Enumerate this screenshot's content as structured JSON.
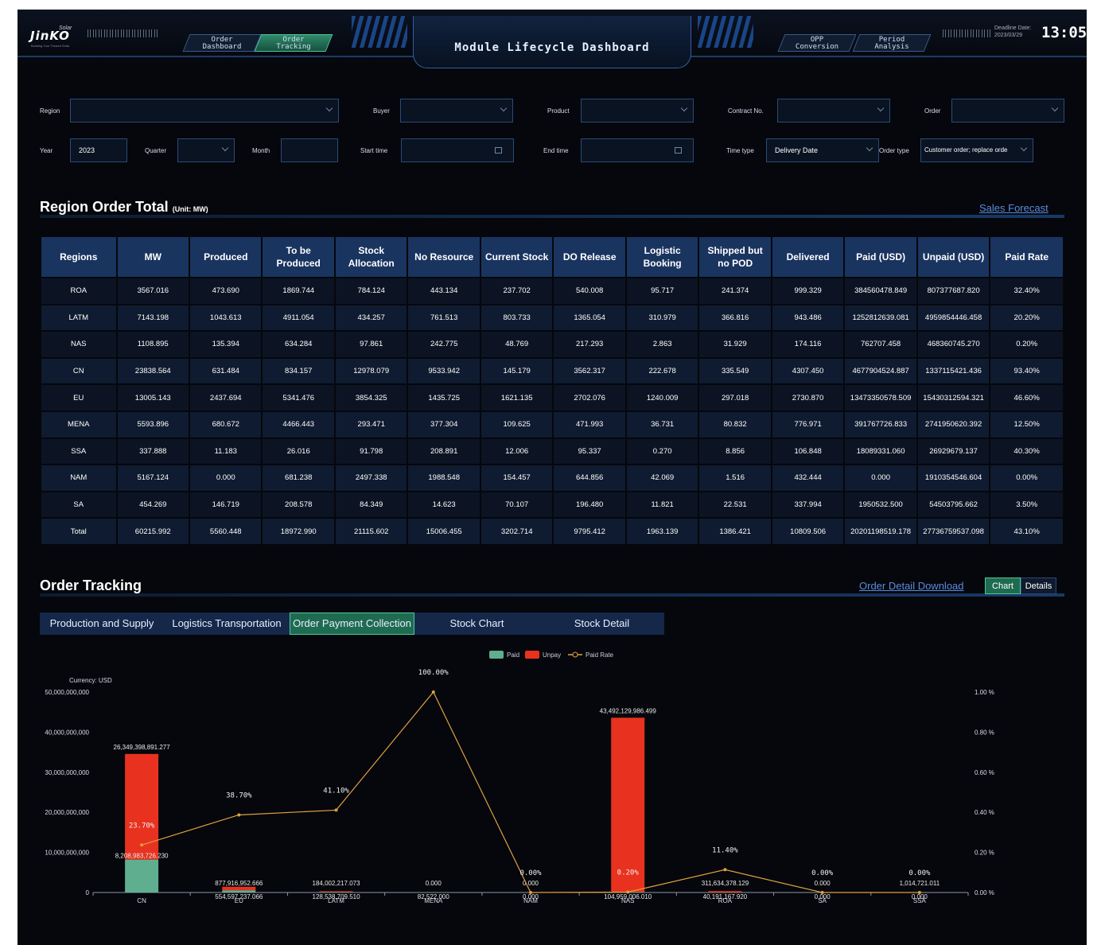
{
  "header": {
    "logo_text": "JinKO",
    "logo_sub": "Solar",
    "logo_tagline": "Building Your Trusted Solar",
    "nav_left": [
      {
        "label": "Order\nDashboard",
        "active": false
      },
      {
        "label": "Order\nTracking",
        "active": true
      }
    ],
    "title": "Module Lifecycle Dashboard",
    "nav_right": [
      {
        "label": "OPP\nConversion",
        "active": false
      },
      {
        "label": "Period\nAnalysis",
        "active": false
      }
    ],
    "deadline_label": "Deadline Date:",
    "deadline_date": "2023/03/29",
    "clock": "13:05"
  },
  "filters": {
    "region": {
      "label": "Region",
      "value": ""
    },
    "buyer": {
      "label": "Buyer",
      "value": ""
    },
    "product": {
      "label": "Product",
      "value": ""
    },
    "contract": {
      "label": "Contract No.",
      "value": ""
    },
    "order": {
      "label": "Order",
      "value": ""
    },
    "year": {
      "label": "Year",
      "value": "2023"
    },
    "quarter": {
      "label": "Quarter",
      "value": ""
    },
    "month": {
      "label": "Month",
      "value": ""
    },
    "start_time": {
      "label": "Start time",
      "value": ""
    },
    "end_time": {
      "label": "End time",
      "value": ""
    },
    "time_type": {
      "label": "Time type",
      "value": "Delivery Date"
    },
    "order_type": {
      "label": "Order type",
      "value": "Customer order; replace orde"
    }
  },
  "region_section": {
    "title": "Region Order Total",
    "unit": "(Unit: MW)",
    "link": "Sales Forecast",
    "columns": [
      "Regions",
      "MW",
      "Produced",
      "To be Produced",
      "Stock Allocation",
      "No Resource",
      "Current Stock",
      "DO Release",
      "Logistic Booking",
      "Shipped but no POD",
      "Delivered",
      "Paid (USD)",
      "Unpaid (USD)",
      "Paid Rate"
    ],
    "rows": [
      [
        "ROA",
        "3567.016",
        "473.690",
        "1869.744",
        "784.124",
        "443.134",
        "237.702",
        "540.008",
        "95.717",
        "241.374",
        "999.329",
        "384560478.849",
        "807377687.820",
        "32.40%"
      ],
      [
        "LATM",
        "7143.198",
        "1043.613",
        "4911.054",
        "434.257",
        "761.513",
        "803.733",
        "1365.054",
        "310.979",
        "366.816",
        "943.486",
        "1252812639.081",
        "4959854446.458",
        "20.20%"
      ],
      [
        "NAS",
        "1108.895",
        "135.394",
        "634.284",
        "97.861",
        "242.775",
        "48.769",
        "217.293",
        "2.863",
        "31.929",
        "174.116",
        "762707.458",
        "468360745.270",
        "0.20%"
      ],
      [
        "CN",
        "23838.564",
        "631.484",
        "834.157",
        "12978.079",
        "9533.942",
        "145.179",
        "3562.317",
        "222.678",
        "335.549",
        "4307.450",
        "4677904524.887",
        "1337115421.436",
        "93.40%"
      ],
      [
        "EU",
        "13005.143",
        "2437.694",
        "5341.476",
        "3854.325",
        "1435.725",
        "1621.135",
        "2702.076",
        "1240.009",
        "297.018",
        "2730.870",
        "13473350578.509",
        "15430312594.321",
        "46.60%"
      ],
      [
        "MENA",
        "5593.896",
        "680.672",
        "4466.443",
        "293.471",
        "377.304",
        "109.625",
        "471.993",
        "36.731",
        "80.832",
        "776.971",
        "391767726.833",
        "2741950620.392",
        "12.50%"
      ],
      [
        "SSA",
        "337.888",
        "11.183",
        "26.016",
        "91.798",
        "208.891",
        "12.006",
        "95.337",
        "0.270",
        "8.856",
        "106.848",
        "18089331.060",
        "26929679.137",
        "40.30%"
      ],
      [
        "NAM",
        "5167.124",
        "0.000",
        "681.238",
        "2497.338",
        "1988.548",
        "154.457",
        "644.856",
        "42.069",
        "1.516",
        "432.444",
        "0.000",
        "1910354546.604",
        "0.00%"
      ],
      [
        "SA",
        "454.269",
        "146.719",
        "208.578",
        "84.349",
        "14.623",
        "70.107",
        "196.480",
        "11.821",
        "22.531",
        "337.994",
        "1950532.500",
        "54503795.662",
        "3.50%"
      ],
      [
        "Total",
        "60215.992",
        "5560.448",
        "18972.990",
        "21115.602",
        "15006.455",
        "3202.714",
        "9795.412",
        "1963.139",
        "1386.421",
        "10809.506",
        "20201198519.178",
        "27736759537.098",
        "43.10%"
      ]
    ]
  },
  "tracking_section": {
    "title": "Order Tracking",
    "link": "Order Detail Download",
    "toggle": [
      {
        "label": "Chart",
        "active": true
      },
      {
        "label": "Details",
        "active": false
      }
    ],
    "tabs": [
      {
        "label": "Production and Supply",
        "active": false
      },
      {
        "label": "Logistics Transportation",
        "active": false
      },
      {
        "label": "Order Payment Collection",
        "active": true
      },
      {
        "label": "Stock Chart",
        "active": false
      },
      {
        "label": "Stock Detail",
        "active": false
      }
    ]
  },
  "chart_data": {
    "type": "bar",
    "currency_label": "Currency: USD",
    "categories": [
      "CN",
      "EU",
      "LATM",
      "MENA",
      "NAM",
      "NAS",
      "ROA",
      "SA",
      "SSA"
    ],
    "series": [
      {
        "name": "Paid",
        "type": "bar",
        "color": "#5fae8f",
        "values": [
          8208983726.23,
          554597237.066,
          128538709.51,
          82522000,
          0,
          104959006.01,
          40191167.92,
          0,
          0
        ],
        "labels": [
          "8,208,983,726.230",
          "554,597,237.066",
          "128,538,709.510",
          "82,522,000",
          "0.000",
          "104,959,006.010",
          "40,191,167.920",
          "0.000",
          "0.000"
        ]
      },
      {
        "name": "Unpay",
        "type": "bar",
        "color": "#e8321f",
        "values": [
          26349398891.277,
          877916952.666,
          184002217.073,
          0,
          0,
          43492129986.499,
          311634378.129,
          0,
          1014721.011
        ],
        "labels": [
          "26,349,398,891.277",
          "877,916,952.666",
          "184,002,217.073",
          "0.000",
          "0.000",
          "43,492,129,986.499",
          "311,634,378.129",
          "0.000",
          "1,014,721.011"
        ]
      },
      {
        "name": "Paid Rate",
        "type": "line",
        "color": "#e0a040",
        "values": [
          0.237,
          0.387,
          0.411,
          1.0,
          0,
          0.002,
          0.114,
          0,
          0
        ],
        "labels": [
          "23.70%",
          "38.70%",
          "41.10%",
          "100.00%",
          "0.00%",
          "0.20%",
          "11.40%",
          "0.00%",
          "0.00%"
        ]
      }
    ],
    "y_left": {
      "min": 0,
      "max": 50000000000,
      "ticks": [
        "0",
        "10,000,000,000",
        "20,000,000,000",
        "30,000,000,000",
        "40,000,000,000",
        "50,000,000,000"
      ]
    },
    "y_right": {
      "min": 0,
      "max": 1,
      "ticks": [
        "0.00 %",
        "0.20 %",
        "0.40 %",
        "0.60 %",
        "0.80 %",
        "1.00 %"
      ]
    },
    "legend_position": "top-center",
    "grid": false
  }
}
